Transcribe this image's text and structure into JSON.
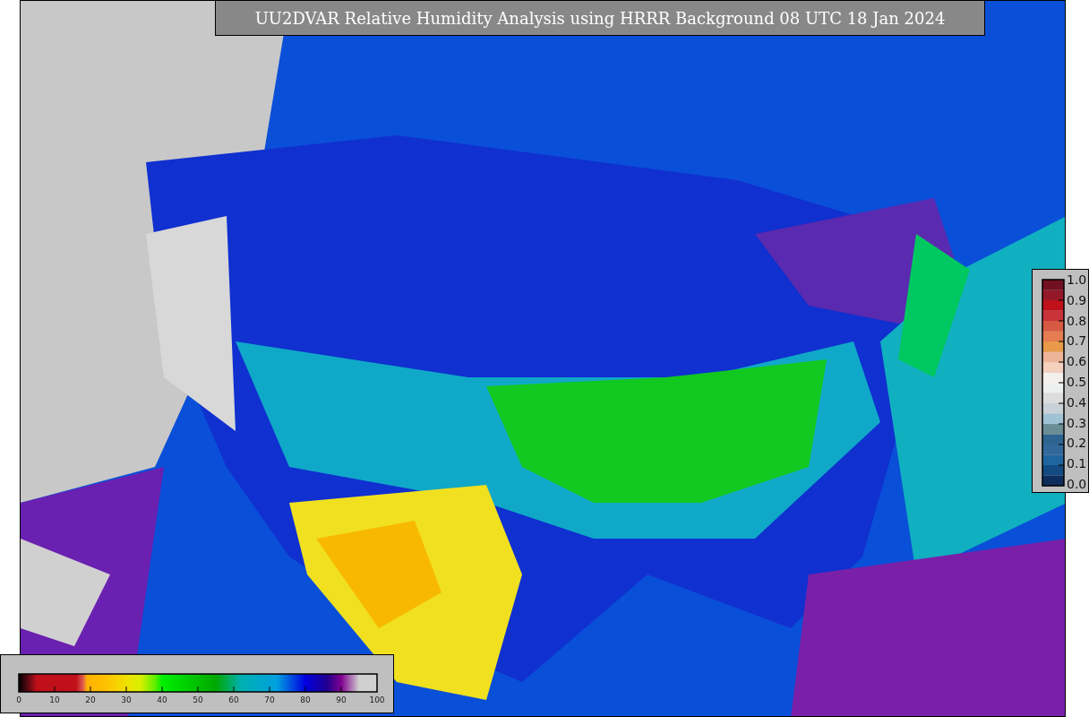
{
  "title": "UU2DVAR Relative Humidity Analysis using HRRR Background 08 UTC 18 Jan 2024",
  "error_legend": {
    "ticks": [
      "1.0",
      "0.9",
      "0.8",
      "0.7",
      "0.6",
      "0.5",
      "0.4",
      "0.3",
      "0.2",
      "0.1",
      "0.0"
    ]
  },
  "humidity_legend": {
    "ticks": [
      "0",
      "10",
      "20",
      "30",
      "40",
      "50",
      "60",
      "70",
      "80",
      "90",
      "100"
    ]
  }
}
